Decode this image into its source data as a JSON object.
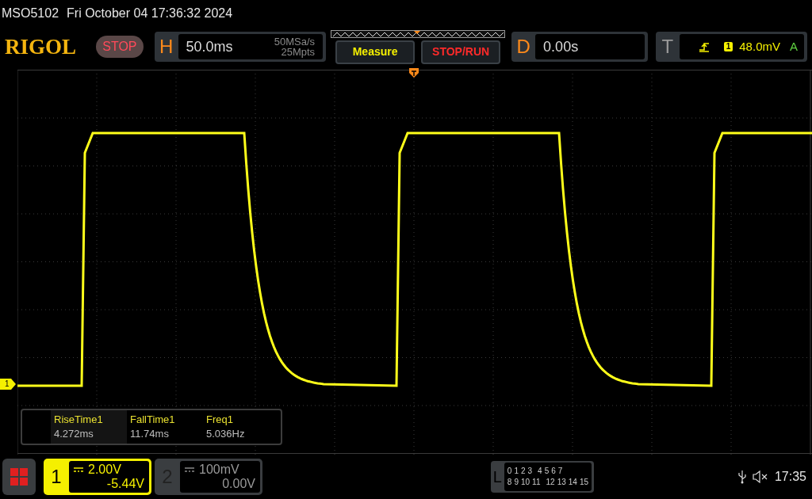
{
  "status_line": {
    "model": "MSO5102",
    "datetime": "Fri October 04 17:36:32 2024"
  },
  "logo": "RIGOL",
  "run_state": {
    "label": "STOP"
  },
  "horizontal": {
    "key": "H",
    "timebase": "50.0ms",
    "sample_rate": "50MSa/s",
    "memory_depth": "25Mpts"
  },
  "buttons": [
    {
      "label": "Measure",
      "kind": "measure"
    },
    {
      "label": "STOP/RUN",
      "kind": "stoprun"
    }
  ],
  "delay": {
    "key": "D",
    "value": "0.00s"
  },
  "trigger": {
    "key": "T",
    "source": "1",
    "level": "48.0mV",
    "mode": "A"
  },
  "measurements": [
    {
      "name": "RiseTime1",
      "value": "4.272ms"
    },
    {
      "name": "FallTime1",
      "value": "11.74ms"
    },
    {
      "name": "Freq1",
      "value": "5.036Hz"
    }
  ],
  "channel_marker": "1",
  "channels": [
    {
      "number": "1",
      "scale": "2.00V",
      "offset": "-5.44V",
      "selected": true
    },
    {
      "number": "2",
      "scale": "100mV",
      "offset": "0.00V",
      "selected": false
    }
  ],
  "logic": {
    "key": "L",
    "row_1": [
      "0",
      "1",
      "2",
      "3",
      "4",
      "5",
      "6",
      "7"
    ],
    "row_2": [
      "8",
      "9",
      "10",
      "11",
      "12",
      "13",
      "14",
      "15"
    ]
  },
  "clock": "17:35"
}
